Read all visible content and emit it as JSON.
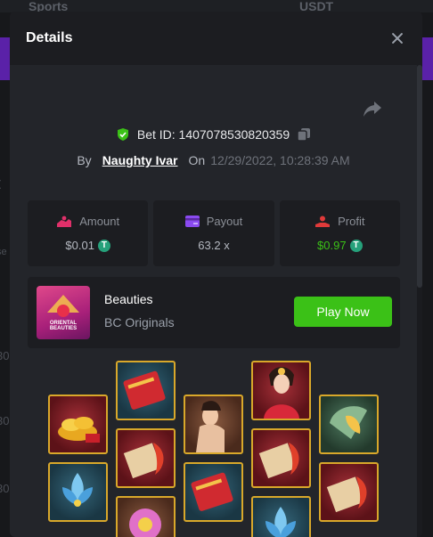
{
  "backdrop": {
    "nav_text": "Sports",
    "currency_text": "USDT",
    "left_letters": [
      "t",
      "se",
      "30",
      "30",
      "30"
    ]
  },
  "modal": {
    "title": "Details"
  },
  "bet": {
    "id_label": "Bet ID: 1407078530820359",
    "by_label": "By",
    "username": "Naughty Ivar",
    "on_label": "On",
    "date": "12/29/2022, 10:28:39 AM"
  },
  "stats": [
    {
      "label": "Amount",
      "value": "$0.01",
      "icon": "amount-icon",
      "color": "#b4b8c0"
    },
    {
      "label": "Payout",
      "value": "63.2 x",
      "icon": "payout-icon",
      "color": "#b4b8c0"
    },
    {
      "label": "Profit",
      "value": "$0.97",
      "icon": "profit-icon",
      "color": "#3bc117"
    }
  ],
  "currency_icon": "usdt-icon",
  "game": {
    "name": "Beauties",
    "provider": "BC Originals",
    "thumbnail_text": "ORIENTAL BEAUTIES",
    "play_label": "Play Now"
  },
  "reels": {
    "symbols": [
      [
        "gold-ingots-icon",
        "blue-lotus-icon"
      ],
      [
        "red-book-icon",
        "scroll-koi-icon",
        "flower-icon"
      ],
      [
        "lady-fan-icon",
        "red-book-icon"
      ],
      [
        "beauty-portrait-icon",
        "scroll-koi-icon",
        "blue-lotus-icon"
      ],
      [
        "jade-fan-icon",
        "scroll-koi-icon"
      ]
    ]
  },
  "colors": {
    "accent_green": "#3bc117",
    "tile_border": "#d9a82a",
    "modal_bg": "#23252a"
  }
}
